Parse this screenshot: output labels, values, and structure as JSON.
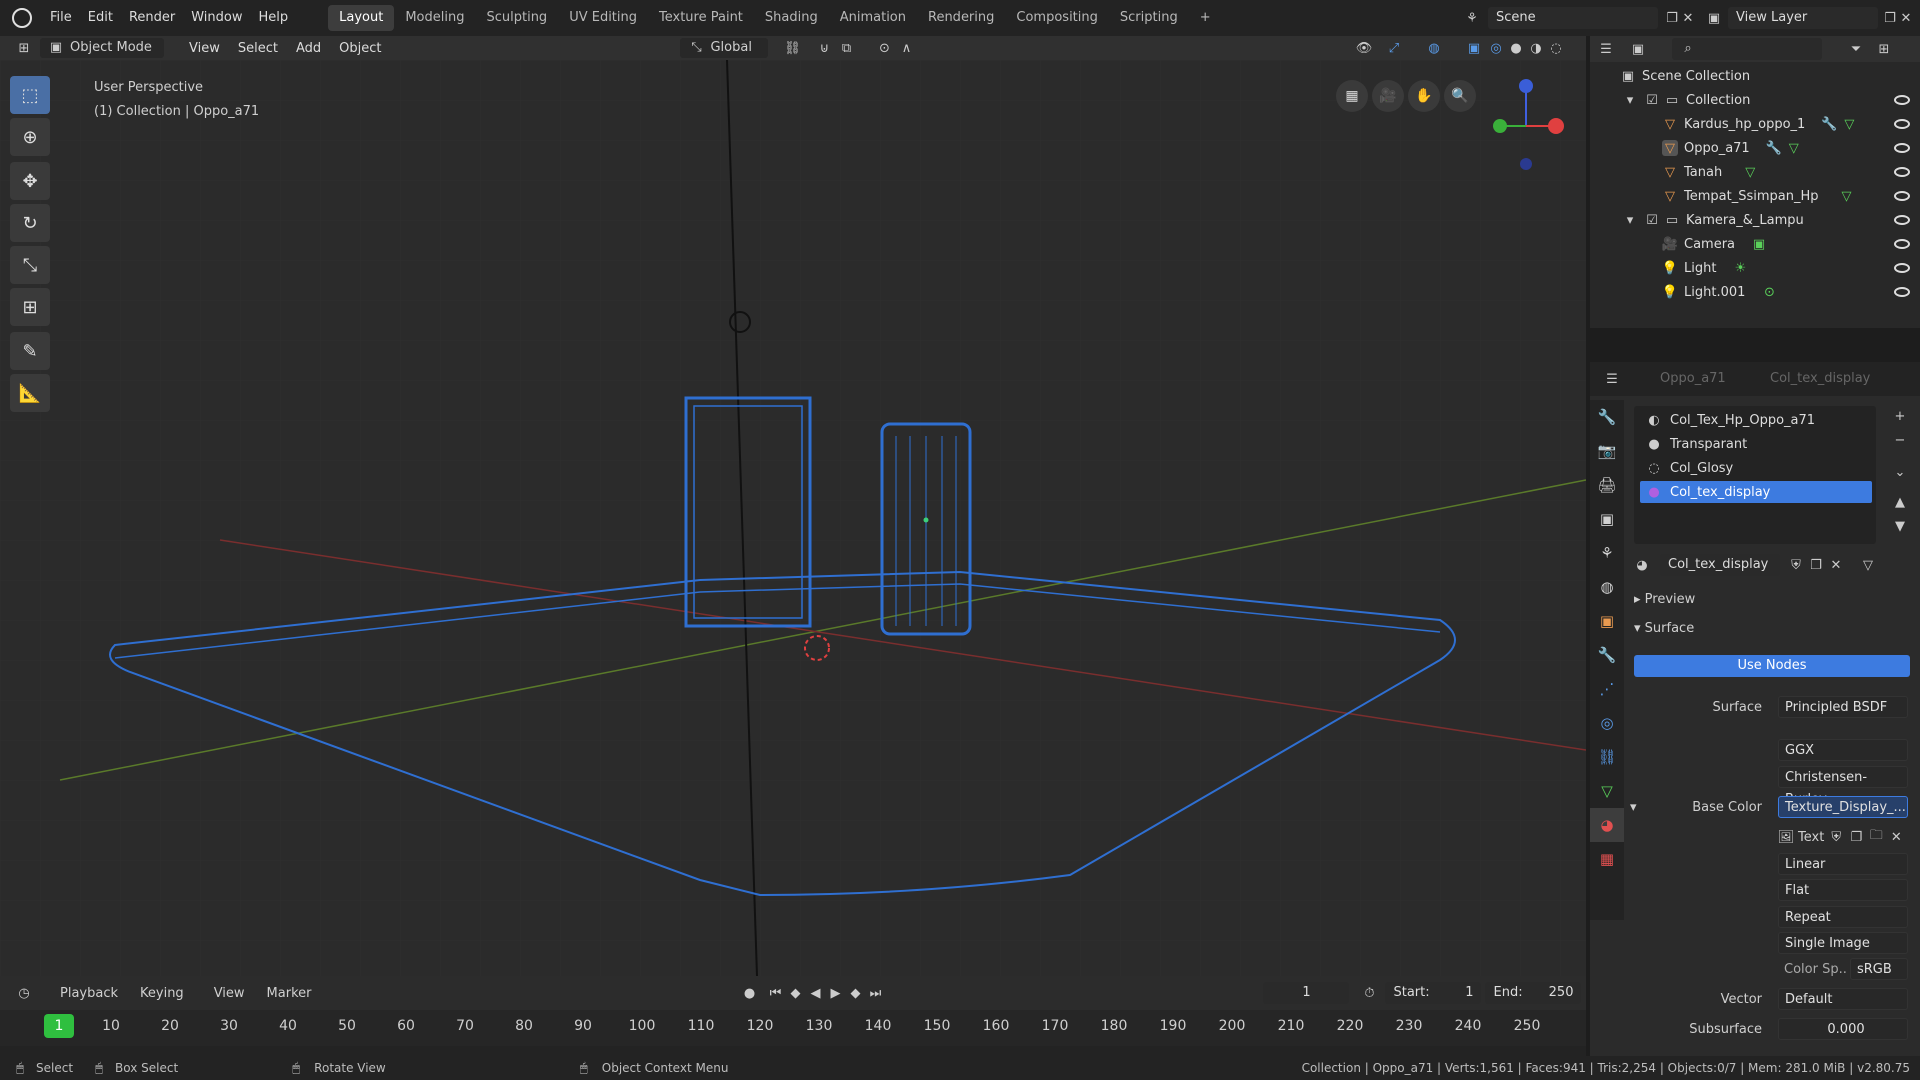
{
  "menu": {
    "items": [
      "File",
      "Edit",
      "Render",
      "Window",
      "Help"
    ],
    "workspaces": [
      "Layout",
      "Modeling",
      "Sculpting",
      "UV Editing",
      "Texture Paint",
      "Shading",
      "Animation",
      "Rendering",
      "Compositing",
      "Scripting"
    ],
    "scene": "Scene",
    "view_layer": "View Layer"
  },
  "header3d": {
    "mode": "Object Mode",
    "menus": [
      "View",
      "Select",
      "Add",
      "Object"
    ],
    "orientation": "Global"
  },
  "viewport": {
    "perspective": "User Perspective",
    "collection_info": "(1) Collection | Oppo_a71"
  },
  "outliner": {
    "root": "Scene Collection",
    "rows": [
      {
        "label": "Collection",
        "type": "collection"
      },
      {
        "label": "Kardus_hp_oppo_1",
        "type": "mesh"
      },
      {
        "label": "Oppo_a71",
        "type": "mesh"
      },
      {
        "label": "Tanah",
        "type": "mesh"
      },
      {
        "label": "Tempat_Ssimpan_Hp",
        "type": "mesh"
      },
      {
        "label": "Kamera_&_Lampu",
        "type": "collection"
      },
      {
        "label": "Camera",
        "type": "camera"
      },
      {
        "label": "Light",
        "type": "light"
      },
      {
        "label": "Light.001",
        "type": "light"
      }
    ]
  },
  "properties": {
    "breadcrumb": [
      "Oppo_a71",
      "Col_tex_display"
    ],
    "slots": [
      "Col_Tex_Hp_Oppo_a71",
      "Transparant",
      "Col_Glosy",
      "Col_tex_display"
    ],
    "material_name": "Col_tex_display",
    "preview": "Preview",
    "surface_section": "Surface",
    "use_nodes": "Use Nodes",
    "surface_label": "Surface",
    "surface_value": "Principled BSDF",
    "distribution": "GGX",
    "subsurface_method": "Christensen-Burley",
    "base_color_label": "Base Color",
    "base_color_value": "Texture_Display_...",
    "tex_label": "Text",
    "interp": "Linear",
    "projection": "Flat",
    "extension": "Repeat",
    "source": "Single Image",
    "color_space_label": "Color Sp..",
    "color_space": "sRGB",
    "vector_label": "Vector",
    "vector_value": "Default",
    "subsurface_label": "Subsurface",
    "subsurface_value": "0.000"
  },
  "timeline": {
    "menus": [
      "Playback",
      "Keying",
      "View",
      "Marker"
    ],
    "current_frame": "1",
    "start_label": "Start:",
    "start": "1",
    "end_label": "End:",
    "end": "250",
    "frames": [
      "1",
      "10",
      "20",
      "30",
      "40",
      "50",
      "60",
      "70",
      "80",
      "90",
      "100",
      "110",
      "120",
      "130",
      "140",
      "150",
      "160",
      "170",
      "180",
      "190",
      "200",
      "210",
      "220",
      "230",
      "240",
      "250"
    ]
  },
  "status": {
    "select": "Select",
    "box_select": "Box Select",
    "rotate": "Rotate View",
    "context_menu": "Object Context Menu",
    "stats": "Collection | Oppo_a71 | Verts:1,561 | Faces:941 | Tris:2,254 | Objects:0/7 | Mem: 281.0 MiB | v2.80.75"
  }
}
